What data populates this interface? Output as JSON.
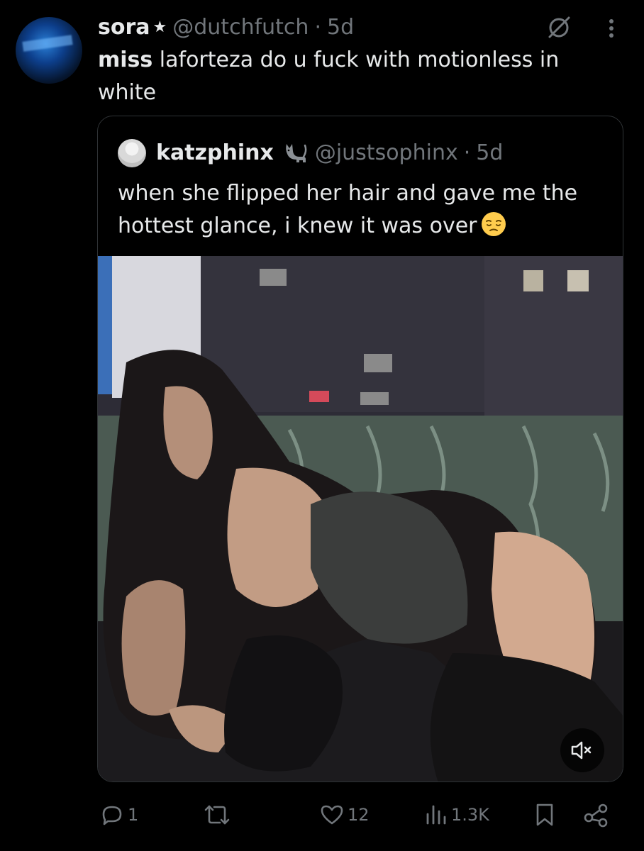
{
  "tweet": {
    "author_name": "sora",
    "author_star": "★",
    "handle": "@dutchfutch",
    "separator": "·",
    "time": "5d",
    "text_bold": "miss",
    "text_rest": " laforteza do u fuck with motionless in white"
  },
  "quote": {
    "author_name": "katzphinx",
    "handle": "@justsophinx",
    "separator": "·",
    "time": "5d",
    "text": "when she flipped her hair and gave me the hottest glance, i knew it was over",
    "emoji": "pensive-face"
  },
  "actions": {
    "replies": "1",
    "reposts": "",
    "likes": "12",
    "views": "1.3K"
  },
  "colors": {
    "background": "#000000",
    "text": "#e7e9ea",
    "muted": "#71767b",
    "border": "#2f3336"
  },
  "icons": [
    "grok-icon",
    "more-icon",
    "cat-icon",
    "mute-icon",
    "reply-icon",
    "repost-icon",
    "like-icon",
    "views-icon",
    "bookmark-icon",
    "share-icon"
  ]
}
